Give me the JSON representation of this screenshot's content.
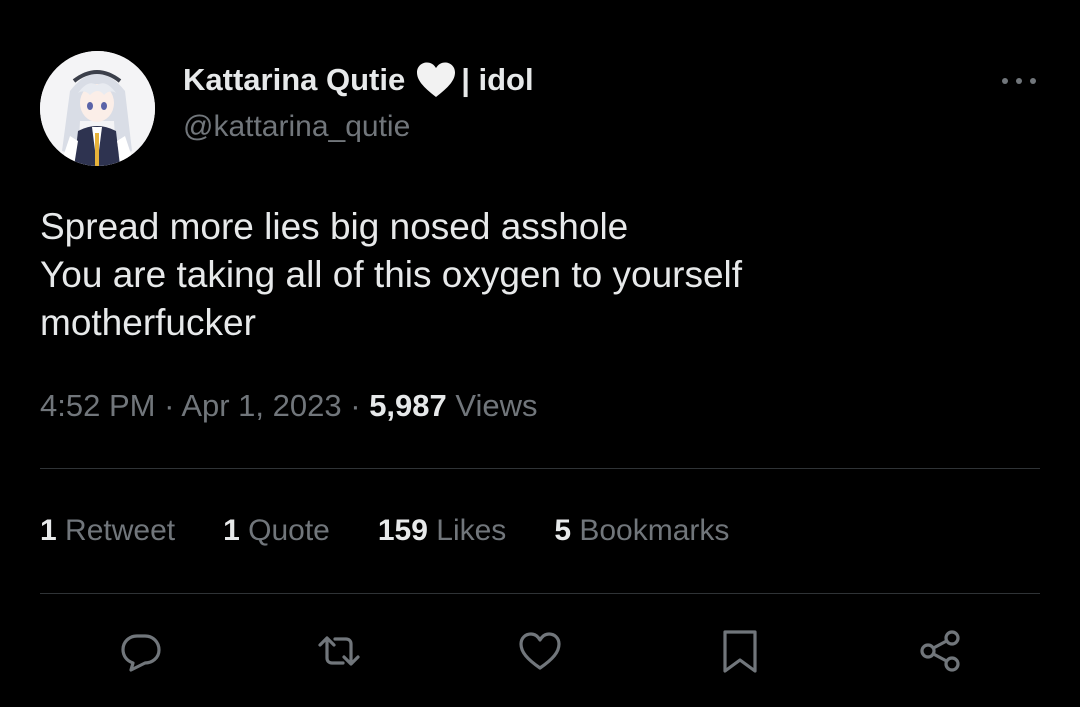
{
  "author": {
    "display_name": "Kattarina Qutie",
    "name_emoji_icon": "white-heart-icon",
    "name_suffix": "| idol",
    "handle": "@kattarina_qutie",
    "avatar_icon": "anime-avatar"
  },
  "more_icon": "more-dots-icon",
  "tweet": {
    "lines": [
      "Spread more lies big nosed asshole",
      "You are taking all of this oxygen to yourself",
      "motherfucker"
    ]
  },
  "meta": {
    "time": "4:52 PM",
    "separator": "·",
    "date": "Apr 1, 2023",
    "views_count": "5,987",
    "views_label": "Views"
  },
  "stats": [
    {
      "count": "1",
      "label": "Retweet"
    },
    {
      "count": "1",
      "label": "Quote"
    },
    {
      "count": "159",
      "label": "Likes"
    },
    {
      "count": "5",
      "label": "Bookmarks"
    }
  ],
  "actions": [
    {
      "icon": "reply-icon"
    },
    {
      "icon": "retweet-icon"
    },
    {
      "icon": "like-heart-icon"
    },
    {
      "icon": "bookmark-icon"
    },
    {
      "icon": "share-icon"
    }
  ],
  "colors": {
    "background": "#000000",
    "primary_text": "#e7e9ea",
    "secondary_text": "#71767b",
    "divider": "#2f3336"
  }
}
